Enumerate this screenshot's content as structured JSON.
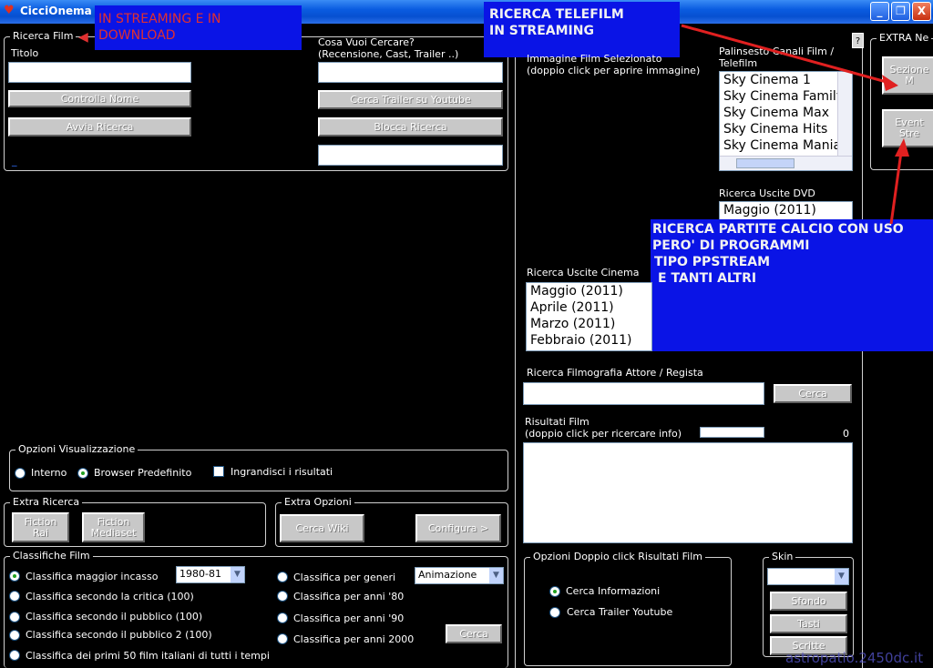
{
  "window": {
    "title": "CicciOnema",
    "minimize": "_",
    "maximize": "❐",
    "close": "X",
    "help": "?"
  },
  "ricerca_film": {
    "legend": "Ricerca Film",
    "titolo_label": "Titolo",
    "titolo_value": "",
    "controlla_nome": "Controlla Nome",
    "avvia_ricerca": "Avvia Ricerca",
    "link": "_",
    "cosa_label_1": "Cosa Vuoi Cercare?",
    "cosa_label_2": "(Recensione, Cast, Trailer ..)",
    "cosa_value": "",
    "cerca_trailer": "Cerca Trailer su Youtube",
    "blocca_ricerca": "Blocca Ricerca",
    "extra_value": ""
  },
  "annotations": {
    "streaming_download": "IN STREAMING E IN DOWNLOAD",
    "telefilm_1": "RICERCA TELEFILM",
    "telefilm_2": "IN STREAMING",
    "calcio_1": "RICERCA PARTITE CALCIO CON USO",
    "calcio_2": "PERO' DI PROGRAMMI",
    "calcio_3": "TIPO PPSTREAM",
    "calcio_4": "E TANTI ALTRI"
  },
  "immagine": {
    "label_1": "Immagine Film Selezionato",
    "label_2": "(doppio click per aprire immagine)"
  },
  "palinsesto": {
    "label_1": "Palinsesto Canali Film /",
    "label_2": "Telefilm",
    "items": [
      "Sky Cinema 1",
      "Sky Cinema Family",
      "Sky Cinema Max",
      "Sky Cinema Hits",
      "Sky Cinema Mania"
    ]
  },
  "uscite_dvd": {
    "label": "Ricerca Uscite DVD",
    "items": [
      "Maggio  (2011)"
    ]
  },
  "uscite_cinema": {
    "label": "Ricerca Uscite Cinema",
    "items": [
      "Maggio  (2011)",
      "Aprile  (2011)",
      "Marzo  (2011)",
      "Febbraio  (2011)"
    ]
  },
  "filmografia": {
    "label": "Ricerca Filmografia Attore / Regista",
    "value": "",
    "cerca": "Cerca"
  },
  "risultati": {
    "label_1": "Risultati Film",
    "label_2": "(doppio click per ricercare info)",
    "count": "0"
  },
  "extra_net": {
    "legend": "EXTRA Ne",
    "btn1_1": "Sezione",
    "btn1_2": "M",
    "btn2_1": "Event",
    "btn2_2": "Stre"
  },
  "opzioni_vis": {
    "legend": "Opzioni Visualizzazione",
    "interno": "Interno",
    "browser": "Browser Predefinito",
    "ingrandisci": "Ingrandisci i risultati"
  },
  "extra_ricerca": {
    "legend": "Extra Ricerca",
    "fiction_rai_1": "Fiction",
    "fiction_rai_2": "Rai",
    "fiction_med_1": "Fiction",
    "fiction_med_2": "Mediaset"
  },
  "extra_opzioni": {
    "legend": "Extra Opzioni",
    "cerca_wiki": "Cerca Wiki",
    "configura": "Configura >"
  },
  "classifiche": {
    "legend": "Classifiche Film",
    "left": [
      "Classifica maggior incasso",
      "Classifica secondo la critica (100)",
      "Classifica secondo il pubblico (100)",
      "Classifica secondo il pubblico 2 (100)",
      "Classifica dei primi 50 film italiani di tutti i tempi"
    ],
    "right": [
      "Classifica per generi",
      "Classifica per anni '80",
      "Classifica per anni '90",
      "Classifica per anni 2000"
    ],
    "anno": "1980-81",
    "genere": "Animazione",
    "cerca": "Cerca"
  },
  "doppio_click": {
    "legend": "Opzioni Doppio click Risultati Film",
    "info": "Cerca Informazioni",
    "trailer": "Cerca Trailer Youtube"
  },
  "skin": {
    "legend": "Skin",
    "value": "",
    "sfondo": "Sfondo",
    "tasti": "Tasti",
    "scritte": "Scritte"
  },
  "watermark": "astropatio.2450dc.it"
}
